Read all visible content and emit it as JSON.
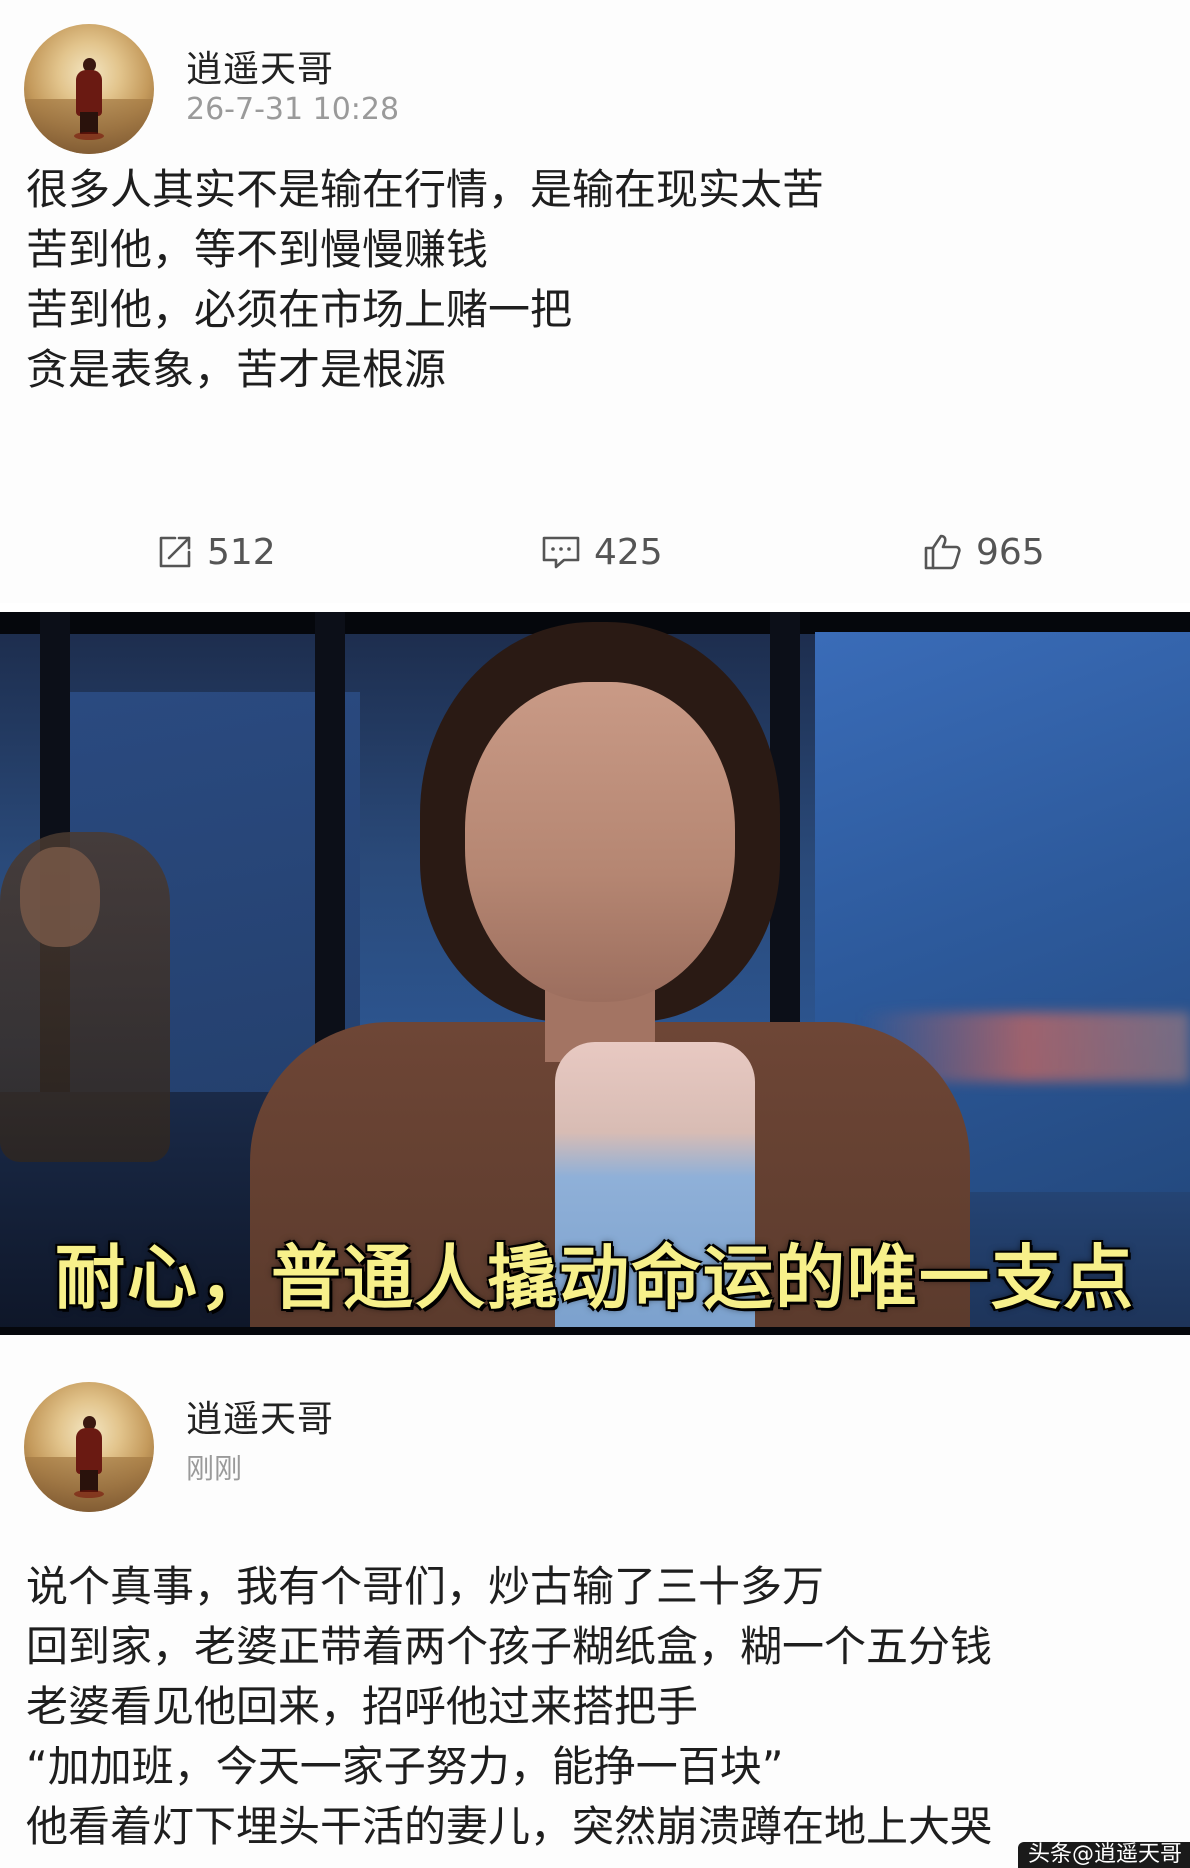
{
  "post1": {
    "username": "逍遥天哥",
    "timestamp": "26-7-31 10:28",
    "lines": [
      "很多人其实不是输在行情，是输在现实太苦",
      "苦到他，等不到慢慢赚钱",
      "苦到他，必须在市场上赌一把",
      "贪是表象，苦才是根源"
    ],
    "actions": {
      "share_count": "512",
      "comment_count": "425",
      "like_count": "965"
    }
  },
  "video": {
    "subtitle": "耐心，普通人撬动命运的唯一支点"
  },
  "post2": {
    "username": "逍遥天哥",
    "timestamp": "刚刚",
    "lines": [
      "说个真事，我有个哥们，炒古输了三十多万",
      "回到家，老婆正带着两个孩子糊纸盒，糊一个五分钱",
      "老婆看见他回来，招呼他过来搭把手",
      "“加加班，今天一家子努力，能挣一百块”",
      "他看着灯下埋头干活的妻儿，突然崩溃蹲在地上大哭"
    ]
  },
  "watermark": "头条@逍遥天哥",
  "icons": {
    "share": "share-icon",
    "comment": "comment-icon",
    "like": "thumbs-up-icon"
  }
}
